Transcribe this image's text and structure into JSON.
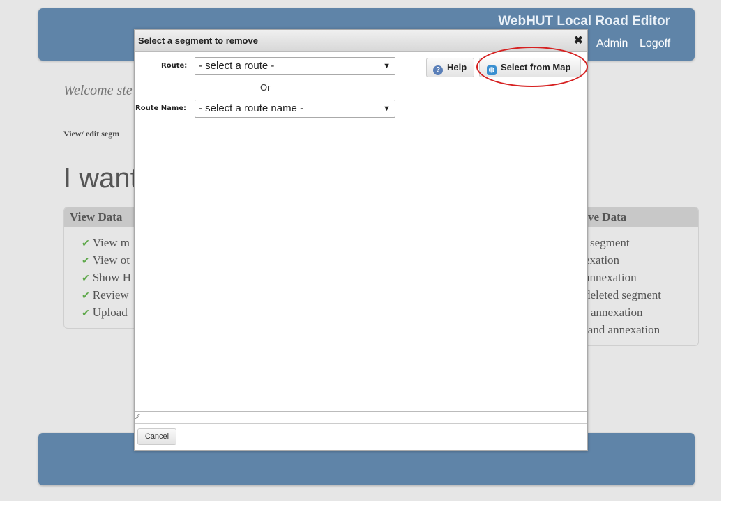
{
  "header": {
    "title": "WebHUT Local Road Editor",
    "nav": {
      "admin": "Admin",
      "logoff": "Logoff"
    }
  },
  "main": {
    "welcome": "Welcome ste",
    "view_edit": "View/ edit segm",
    "i_want": "I want",
    "left_panel": {
      "title": "View Data",
      "items": [
        "View m",
        "View ot",
        "Show H",
        "Review",
        "Upload"
      ]
    },
    "right_panel": {
      "title": "ve Data",
      "items": [
        "segment",
        "exation",
        "annexation",
        "deleted segment",
        "l annexation",
        "land annexation"
      ]
    }
  },
  "dialog": {
    "title": "Select a segment to remove",
    "close": "✖",
    "route_label": "Route:",
    "route_value": "- select a route -",
    "or_text": "Or",
    "route_name_label": "Route Name:",
    "route_name_value": "- select a route name -",
    "help_label": "Help",
    "select_map_label": "Select from Map",
    "cancel_label": "Cancel"
  },
  "colors": {
    "header_bg": "#5f84a8",
    "check_green": "#5ea84a",
    "annotation_red": "#d62020"
  },
  "icons": [
    "help-icon",
    "globe-icon",
    "check-icon",
    "close-icon",
    "resize-grip-icon",
    "dropdown-arrow-icon"
  ]
}
